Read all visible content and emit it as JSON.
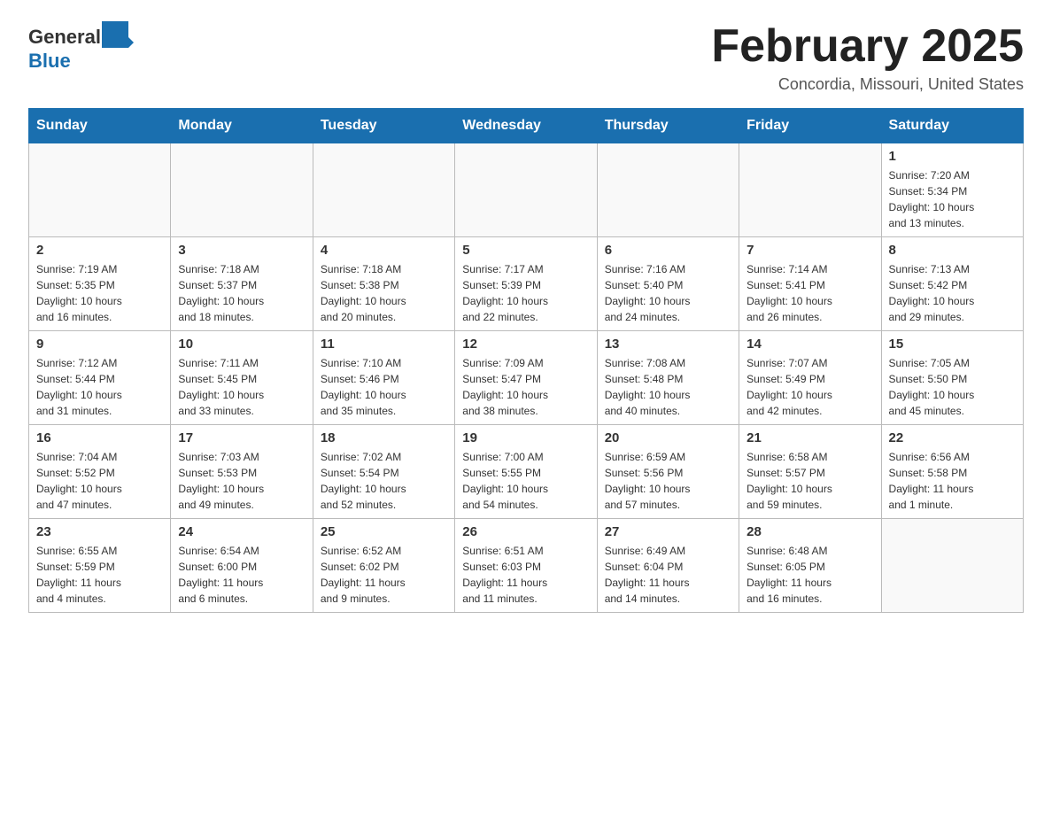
{
  "header": {
    "logo_general": "General",
    "logo_blue": "Blue",
    "month_title": "February 2025",
    "location": "Concordia, Missouri, United States"
  },
  "days_of_week": [
    "Sunday",
    "Monday",
    "Tuesday",
    "Wednesday",
    "Thursday",
    "Friday",
    "Saturday"
  ],
  "weeks": [
    [
      {
        "day": "",
        "info": ""
      },
      {
        "day": "",
        "info": ""
      },
      {
        "day": "",
        "info": ""
      },
      {
        "day": "",
        "info": ""
      },
      {
        "day": "",
        "info": ""
      },
      {
        "day": "",
        "info": ""
      },
      {
        "day": "1",
        "info": "Sunrise: 7:20 AM\nSunset: 5:34 PM\nDaylight: 10 hours\nand 13 minutes."
      }
    ],
    [
      {
        "day": "2",
        "info": "Sunrise: 7:19 AM\nSunset: 5:35 PM\nDaylight: 10 hours\nand 16 minutes."
      },
      {
        "day": "3",
        "info": "Sunrise: 7:18 AM\nSunset: 5:37 PM\nDaylight: 10 hours\nand 18 minutes."
      },
      {
        "day": "4",
        "info": "Sunrise: 7:18 AM\nSunset: 5:38 PM\nDaylight: 10 hours\nand 20 minutes."
      },
      {
        "day": "5",
        "info": "Sunrise: 7:17 AM\nSunset: 5:39 PM\nDaylight: 10 hours\nand 22 minutes."
      },
      {
        "day": "6",
        "info": "Sunrise: 7:16 AM\nSunset: 5:40 PM\nDaylight: 10 hours\nand 24 minutes."
      },
      {
        "day": "7",
        "info": "Sunrise: 7:14 AM\nSunset: 5:41 PM\nDaylight: 10 hours\nand 26 minutes."
      },
      {
        "day": "8",
        "info": "Sunrise: 7:13 AM\nSunset: 5:42 PM\nDaylight: 10 hours\nand 29 minutes."
      }
    ],
    [
      {
        "day": "9",
        "info": "Sunrise: 7:12 AM\nSunset: 5:44 PM\nDaylight: 10 hours\nand 31 minutes."
      },
      {
        "day": "10",
        "info": "Sunrise: 7:11 AM\nSunset: 5:45 PM\nDaylight: 10 hours\nand 33 minutes."
      },
      {
        "day": "11",
        "info": "Sunrise: 7:10 AM\nSunset: 5:46 PM\nDaylight: 10 hours\nand 35 minutes."
      },
      {
        "day": "12",
        "info": "Sunrise: 7:09 AM\nSunset: 5:47 PM\nDaylight: 10 hours\nand 38 minutes."
      },
      {
        "day": "13",
        "info": "Sunrise: 7:08 AM\nSunset: 5:48 PM\nDaylight: 10 hours\nand 40 minutes."
      },
      {
        "day": "14",
        "info": "Sunrise: 7:07 AM\nSunset: 5:49 PM\nDaylight: 10 hours\nand 42 minutes."
      },
      {
        "day": "15",
        "info": "Sunrise: 7:05 AM\nSunset: 5:50 PM\nDaylight: 10 hours\nand 45 minutes."
      }
    ],
    [
      {
        "day": "16",
        "info": "Sunrise: 7:04 AM\nSunset: 5:52 PM\nDaylight: 10 hours\nand 47 minutes."
      },
      {
        "day": "17",
        "info": "Sunrise: 7:03 AM\nSunset: 5:53 PM\nDaylight: 10 hours\nand 49 minutes."
      },
      {
        "day": "18",
        "info": "Sunrise: 7:02 AM\nSunset: 5:54 PM\nDaylight: 10 hours\nand 52 minutes."
      },
      {
        "day": "19",
        "info": "Sunrise: 7:00 AM\nSunset: 5:55 PM\nDaylight: 10 hours\nand 54 minutes."
      },
      {
        "day": "20",
        "info": "Sunrise: 6:59 AM\nSunset: 5:56 PM\nDaylight: 10 hours\nand 57 minutes."
      },
      {
        "day": "21",
        "info": "Sunrise: 6:58 AM\nSunset: 5:57 PM\nDaylight: 10 hours\nand 59 minutes."
      },
      {
        "day": "22",
        "info": "Sunrise: 6:56 AM\nSunset: 5:58 PM\nDaylight: 11 hours\nand 1 minute."
      }
    ],
    [
      {
        "day": "23",
        "info": "Sunrise: 6:55 AM\nSunset: 5:59 PM\nDaylight: 11 hours\nand 4 minutes."
      },
      {
        "day": "24",
        "info": "Sunrise: 6:54 AM\nSunset: 6:00 PM\nDaylight: 11 hours\nand 6 minutes."
      },
      {
        "day": "25",
        "info": "Sunrise: 6:52 AM\nSunset: 6:02 PM\nDaylight: 11 hours\nand 9 minutes."
      },
      {
        "day": "26",
        "info": "Sunrise: 6:51 AM\nSunset: 6:03 PM\nDaylight: 11 hours\nand 11 minutes."
      },
      {
        "day": "27",
        "info": "Sunrise: 6:49 AM\nSunset: 6:04 PM\nDaylight: 11 hours\nand 14 minutes."
      },
      {
        "day": "28",
        "info": "Sunrise: 6:48 AM\nSunset: 6:05 PM\nDaylight: 11 hours\nand 16 minutes."
      },
      {
        "day": "",
        "info": ""
      }
    ]
  ]
}
